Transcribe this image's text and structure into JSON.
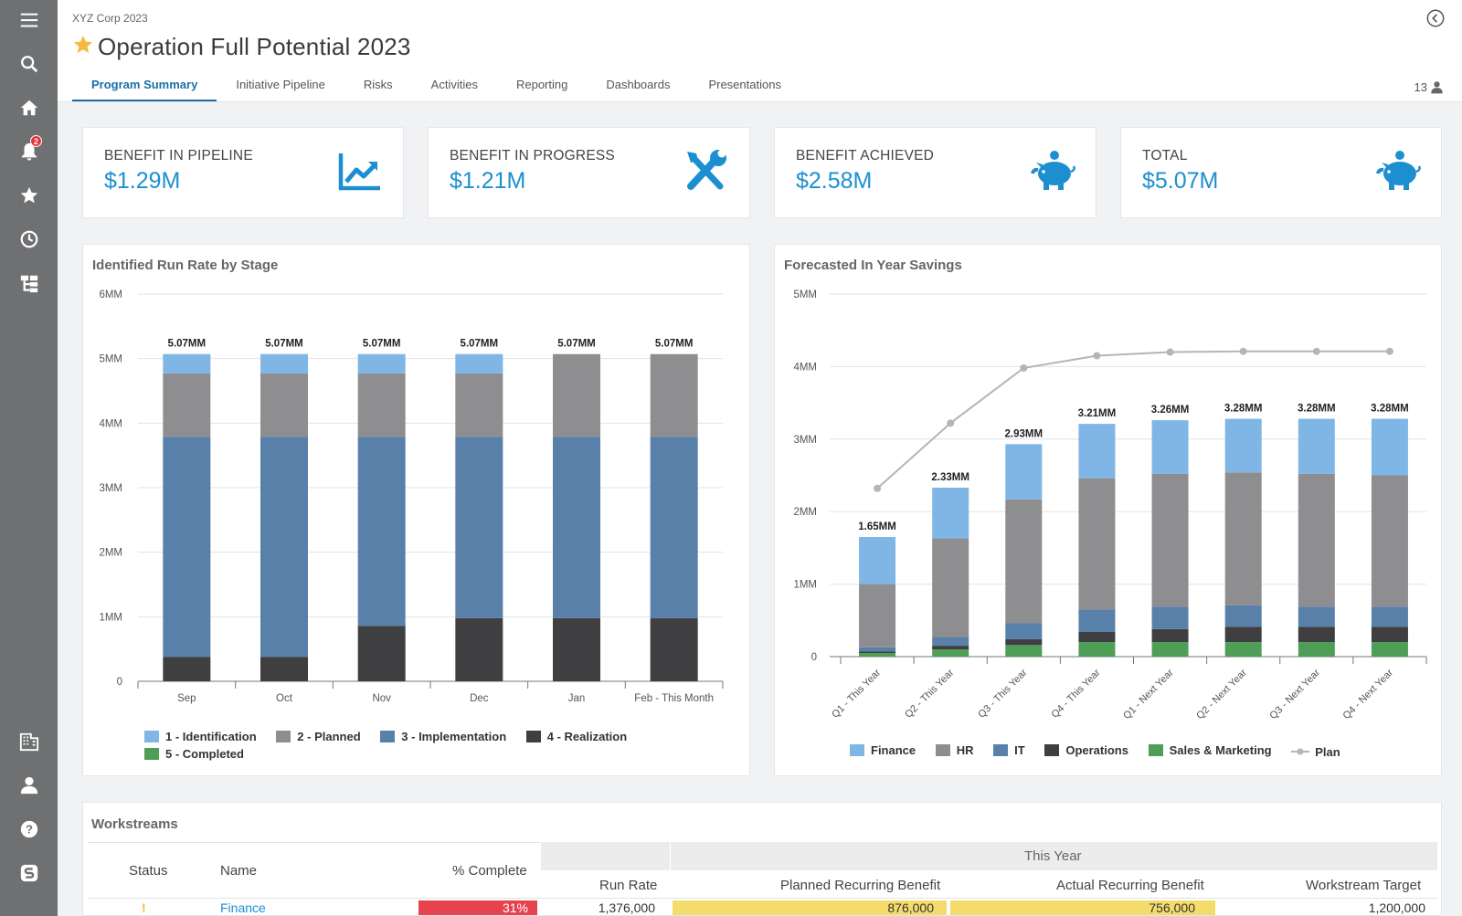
{
  "header": {
    "company": "XYZ Corp 2023",
    "title": "Operation Full Potential 2023",
    "user_count": "13"
  },
  "tabs": [
    {
      "label": "Program Summary",
      "active": true
    },
    {
      "label": "Initiative Pipeline"
    },
    {
      "label": "Risks"
    },
    {
      "label": "Activities"
    },
    {
      "label": "Reporting"
    },
    {
      "label": "Dashboards"
    },
    {
      "label": "Presentations"
    }
  ],
  "sidebar": {
    "notifications_badge": "2",
    "icons": [
      "menu-icon",
      "search-icon",
      "home-icon",
      "bell-icon",
      "star-icon",
      "clock-icon",
      "hierarchy-icon",
      "building-icon",
      "user-icon",
      "help-icon",
      "logo-icon"
    ]
  },
  "kpis": [
    {
      "label": "BENEFIT IN PIPELINE",
      "value": "$1.29M",
      "icon": "chart-trend-icon"
    },
    {
      "label": "BENEFIT IN PROGRESS",
      "value": "$1.21M",
      "icon": "tools-icon"
    },
    {
      "label": "BENEFIT ACHIEVED",
      "value": "$2.58M",
      "icon": "piggy-bank-icon"
    },
    {
      "label": "TOTAL",
      "value": "$5.07M",
      "icon": "piggy-bank-icon"
    }
  ],
  "colors": {
    "accent": "#1a6fa6",
    "kpi_value": "#1d8fd1",
    "identification": "#7fb6e6",
    "planned": "#8e8e90",
    "implementation": "#5980a8",
    "realization": "#3f3f42",
    "completed": "#4f9e57",
    "plan_line": "#b5b5b5"
  },
  "chart_data": [
    {
      "type": "bar",
      "stacked": true,
      "title": "Identified Run Rate by Stage",
      "categories": [
        "Sep",
        "Oct",
        "Nov",
        "Dec",
        "Jan",
        "Feb - This Month"
      ],
      "ylim": [
        0,
        6
      ],
      "yticks": [
        "0",
        "1MM",
        "2MM",
        "3MM",
        "4MM",
        "5MM",
        "6MM"
      ],
      "series": [
        {
          "name": "1 - Identification",
          "values": [
            0.3,
            0.3,
            0.3,
            0.3,
            0.0,
            0.0
          ]
        },
        {
          "name": "2 - Planned",
          "values": [
            0.98,
            0.98,
            0.98,
            0.98,
            1.28,
            1.28
          ]
        },
        {
          "name": "3 - Implementation",
          "values": [
            3.41,
            3.41,
            2.93,
            2.81,
            2.81,
            2.81
          ]
        },
        {
          "name": "4 - Realization",
          "values": [
            0.38,
            0.38,
            0.86,
            0.98,
            0.98,
            0.98
          ]
        },
        {
          "name": "5 - Completed",
          "values": [
            0,
            0,
            0,
            0,
            0,
            0
          ]
        }
      ],
      "data_labels": [
        "5.07MM",
        "5.07MM",
        "5.07MM",
        "5.07MM",
        "5.07MM",
        "5.07MM"
      ],
      "legend": "bottom",
      "grid": true
    },
    {
      "type": "bar",
      "stacked": true,
      "title": "Forecasted In Year Savings",
      "categories": [
        "Q1 - This Year",
        "Q2 - This Year",
        "Q3 - This Year",
        "Q4 - This Year",
        "Q1 - Next Year",
        "Q2 - Next Year",
        "Q3 - Next Year",
        "Q4 - Next Year"
      ],
      "ylim": [
        0,
        5
      ],
      "yticks": [
        "0",
        "1MM",
        "2MM",
        "3MM",
        "4MM",
        "5MM"
      ],
      "series": [
        {
          "name": "Sales & Marketing",
          "values": [
            0.05,
            0.1,
            0.16,
            0.2,
            0.2,
            0.2,
            0.2,
            0.2
          ]
        },
        {
          "name": "Operations",
          "values": [
            0.02,
            0.05,
            0.08,
            0.14,
            0.18,
            0.21,
            0.21,
            0.21
          ]
        },
        {
          "name": "IT",
          "values": [
            0.06,
            0.12,
            0.22,
            0.31,
            0.31,
            0.3,
            0.28,
            0.28
          ]
        },
        {
          "name": "HR",
          "values": [
            0.87,
            1.36,
            1.71,
            1.81,
            1.83,
            1.83,
            1.83,
            1.81
          ]
        },
        {
          "name": "Finance",
          "values": [
            0.65,
            0.7,
            0.76,
            0.75,
            0.74,
            0.74,
            0.76,
            0.78
          ]
        }
      ],
      "line": {
        "name": "Plan",
        "values": [
          2.32,
          3.22,
          3.98,
          4.15,
          4.2,
          4.21,
          4.21,
          4.21
        ]
      },
      "data_labels": [
        "1.65MM",
        "2.33MM",
        "2.93MM",
        "3.21MM",
        "3.26MM",
        "3.28MM",
        "3.28MM",
        "3.28MM"
      ],
      "legend_order": [
        "Finance",
        "HR",
        "IT",
        "Operations",
        "Sales & Marketing",
        "Plan"
      ],
      "legend": "bottom",
      "grid": true
    }
  ],
  "workstreams": {
    "title": "Workstreams",
    "group_header": "This Year",
    "columns": {
      "status": "Status",
      "name": "Name",
      "complete": "% Complete",
      "run_rate": "Run Rate",
      "planned": "Planned Recurring Benefit",
      "actual": "Actual Recurring Benefit",
      "target": "Workstream Target"
    },
    "rows": [
      {
        "status": "!",
        "name": "Finance",
        "complete": "31%",
        "run_rate": "1,376,000",
        "planned": "876,000",
        "actual": "756,000",
        "target": "1,200,000"
      }
    ]
  }
}
